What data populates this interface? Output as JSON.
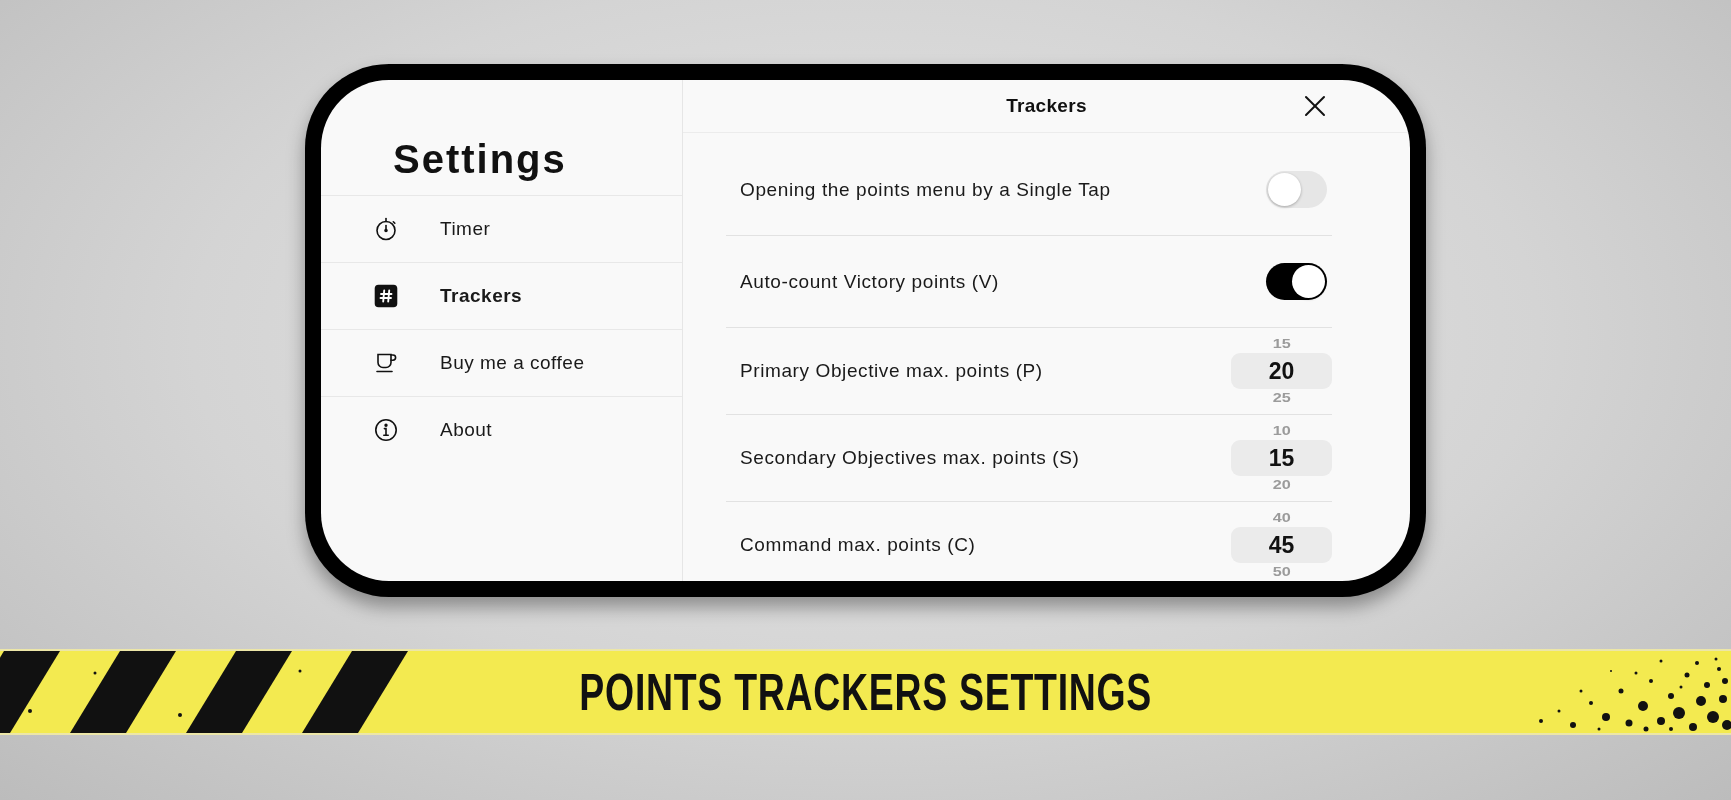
{
  "sidebar": {
    "title": "Settings",
    "items": [
      {
        "label": "Timer",
        "selected": false
      },
      {
        "label": "Trackers",
        "selected": true
      },
      {
        "label": "Buy me a coffee",
        "selected": false
      },
      {
        "label": "About",
        "selected": false
      }
    ]
  },
  "panel": {
    "title": "Trackers",
    "settings": [
      {
        "kind": "toggle",
        "label": "Opening the points menu by a Single Tap",
        "on": false
      },
      {
        "kind": "toggle",
        "label": "Auto-count Victory points (V)",
        "on": true
      },
      {
        "kind": "picker",
        "label": "Primary Objective max. points (P)",
        "previous": "15",
        "value": "20",
        "next": "25"
      },
      {
        "kind": "picker",
        "label": "Secondary Objectives max. points (S)",
        "previous": "10",
        "value": "15",
        "next": "20"
      },
      {
        "kind": "picker",
        "label": "Command max. points (C)",
        "previous": "40",
        "value": "45",
        "next": "50"
      }
    ]
  },
  "banner": {
    "title": "POINTS TRACKERS SETTINGS"
  }
}
